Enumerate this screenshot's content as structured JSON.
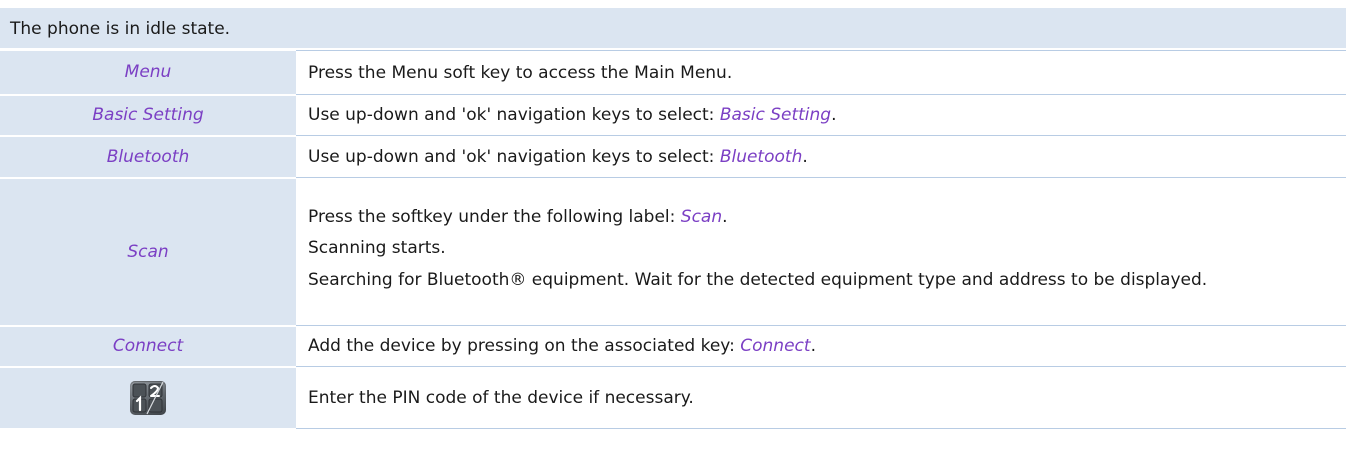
{
  "intro": "The phone is in idle state.",
  "steps": [
    {
      "key": "Menu",
      "lines": [
        {
          "text": "Press the Menu soft key to access the Main Menu."
        }
      ]
    },
    {
      "key": "Basic Setting",
      "lines": [
        {
          "text": "Use up-down and 'ok' navigation keys to select: ",
          "action": "Basic Setting",
          "after": "."
        }
      ]
    },
    {
      "key": "Bluetooth",
      "lines": [
        {
          "text": "Use up-down and 'ok' navigation keys to select: ",
          "action": "Bluetooth",
          "after": "."
        }
      ]
    },
    {
      "key": "Scan",
      "lines": [
        {
          "text": "Press the softkey under the following label: ",
          "action": "Scan",
          "after": "."
        },
        {
          "text": "Scanning starts."
        },
        {
          "text": "Searching for Bluetooth® equipment. Wait for the detected equipment type and address to be displayed."
        }
      ]
    },
    {
      "key": "Connect",
      "lines": [
        {
          "text": "Add the device by pressing on the associated key: ",
          "action": "Connect",
          "after": "."
        }
      ]
    },
    {
      "key_icon": "keypad-icon",
      "lines": [
        {
          "text": "Enter the PIN code of the device if necessary."
        }
      ]
    }
  ],
  "colors": {
    "header_band": "#dbe5f1",
    "action_text": "#7b3fc4",
    "row_rule": "#b8cce4"
  }
}
